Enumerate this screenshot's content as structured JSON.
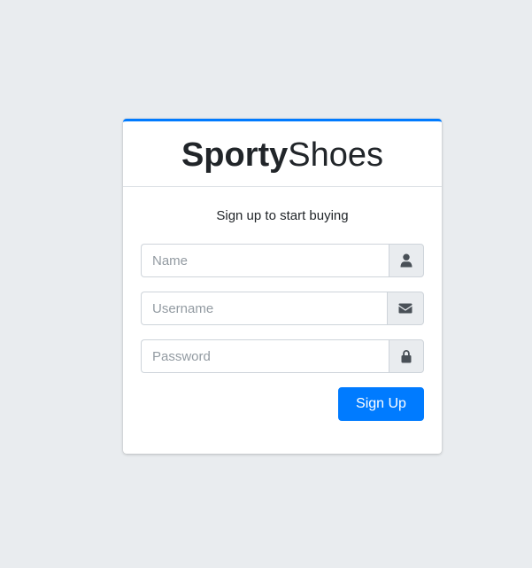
{
  "brand": {
    "bold_part": "Sporty",
    "light_part": "Shoes"
  },
  "form": {
    "subtitle": "Sign up to start buying",
    "name": {
      "placeholder": "Name",
      "value": "",
      "icon": "user-icon"
    },
    "username": {
      "placeholder": "Username",
      "value": "",
      "icon": "envelope-icon"
    },
    "password": {
      "placeholder": "Password",
      "value": "",
      "icon": "lock-icon"
    },
    "submit_label": "Sign Up"
  },
  "colors": {
    "accent": "#007bff",
    "background": "#e9ecef",
    "addon_bg": "#e9ecef"
  }
}
